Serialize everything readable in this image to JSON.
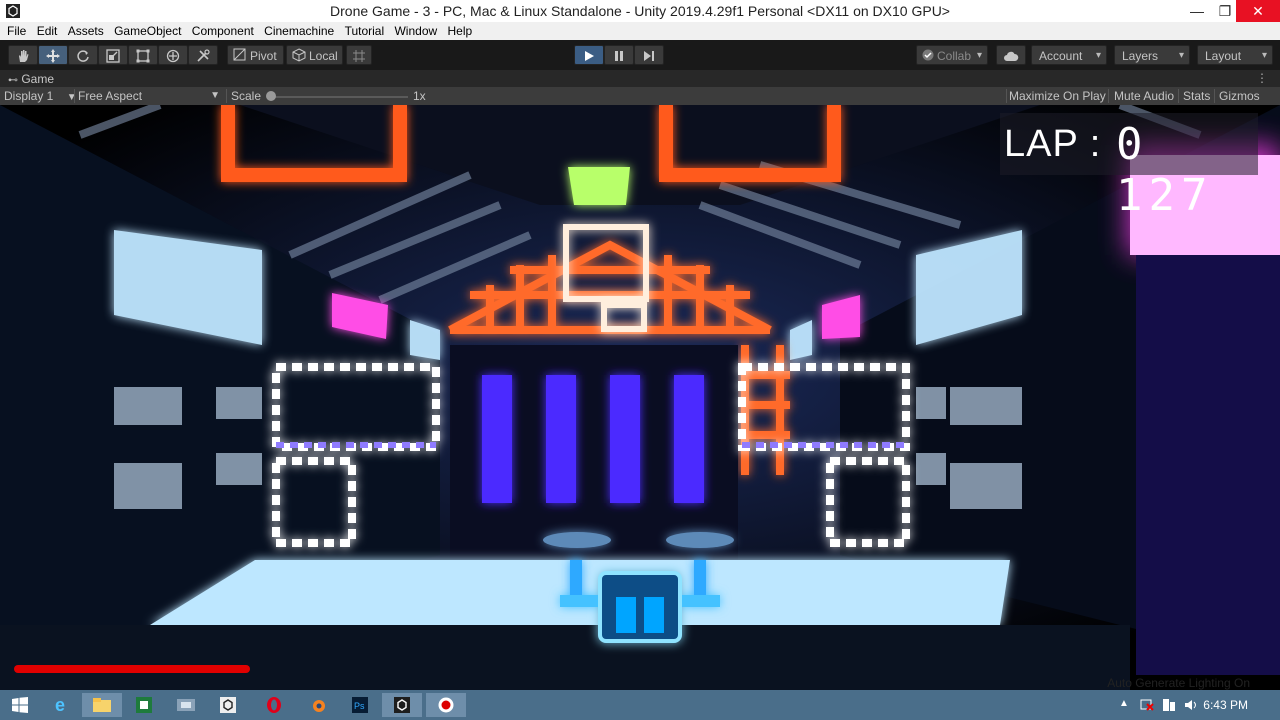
{
  "window": {
    "title": "Drone Game - 3 - PC, Mac & Linux Standalone - Unity 2019.4.29f1 Personal <DX11 on DX10 GPU>"
  },
  "menu": [
    "File",
    "Edit",
    "Assets",
    "GameObject",
    "Component",
    "Cinemachine",
    "Tutorial",
    "Window",
    "Help"
  ],
  "toolbar": {
    "tools": [
      "hand-icon",
      "move-icon",
      "rotate-icon",
      "scale-icon",
      "rect-icon",
      "transform-icon",
      "custom-tool-icon"
    ],
    "pivot_label": "Pivot",
    "local_label": "Local",
    "collab_label": "Collab",
    "account_label": "Account",
    "layers_label": "Layers",
    "layout_label": "Layout"
  },
  "game_tab": {
    "label": "Game"
  },
  "game_bar": {
    "display": "Display 1",
    "aspect": "Free Aspect",
    "scale_label": "Scale",
    "scale_value": "1x",
    "maximize": "Maximize On Play",
    "mute": "Mute Audio",
    "stats": "Stats",
    "gizmos": "Gizmos"
  },
  "hud": {
    "lap_label": "LAP :",
    "lap_value": "0 127",
    "health_fraction": 0.19
  },
  "status_bar": {
    "text": "Auto Generate Lighting On"
  },
  "taskbar": {
    "clock": "6:43 PM",
    "apps": [
      "windows-icon",
      "ie-icon",
      "explorer-icon",
      "excel-icon",
      "unity-hub-icon",
      "unity-icon",
      "opera-icon",
      "blender-icon",
      "photoshop-icon",
      "unity-editor-icon",
      "recorder-icon"
    ]
  },
  "colors": {
    "accent": "#46607c",
    "health": "#e00000",
    "titlebar_close": "#e81123"
  }
}
